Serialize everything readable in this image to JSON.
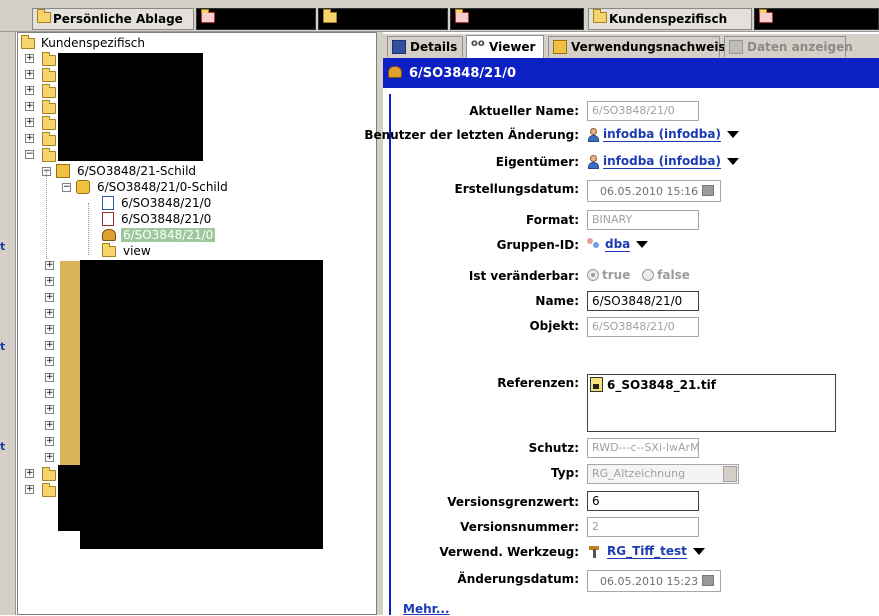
{
  "top_tabs": [
    {
      "label": "Persönliche Ablage",
      "active": false,
      "icon": "folder-icon"
    },
    {
      "label": "",
      "active": false,
      "icon": "folder-red-icon"
    },
    {
      "label": "",
      "active": false,
      "icon": "folder-icon"
    },
    {
      "label": "",
      "active": false,
      "icon": "folder-red-icon"
    },
    {
      "label": "Kundenspezifisch",
      "active": true,
      "icon": "folder-icon"
    },
    {
      "label": "",
      "active": false,
      "icon": "folder-red-icon"
    }
  ],
  "tree": {
    "root": "Kundenspezifisch",
    "nodes": [
      {
        "label": "6/SO3848/21-Schild",
        "icon": "item-icon"
      },
      {
        "label": "6/SO3848/21/0-Schild",
        "icon": "item-revision-icon"
      },
      {
        "label": "6/SO3848/21/0",
        "icon": "form-icon"
      },
      {
        "label": "6/SO3848/21/0",
        "icon": "drawing-icon"
      },
      {
        "label": "6/SO3848/21/0",
        "icon": "dataset-icon",
        "selected": true
      },
      {
        "label": "view",
        "icon": "view-icon"
      }
    ]
  },
  "right_tabs": [
    {
      "label": "Details",
      "icon": "details-icon"
    },
    {
      "label": "Viewer",
      "icon": "viewer-icon",
      "active": true
    },
    {
      "label": "Verwendungsnachweis",
      "icon": "where-used-icon"
    },
    {
      "label": "Daten anzeigen",
      "icon": "data-icon",
      "disabled": true
    }
  ],
  "title": "6/SO3848/21/0",
  "form": {
    "current_name_label": "Aktueller Name:",
    "current_name": "6/SO3848/21/0",
    "last_modified_user_label": "Benutzer der letzten Änderung:",
    "last_modified_user": "infodba (infodba)",
    "owner_label": "Eigentümer:",
    "owner": "infodba (infodba)",
    "creation_date_label": "Erstellungsdatum:",
    "creation_date": "06.05.2010 15:16",
    "format_label": "Format:",
    "format": "BINARY",
    "group_id_label": "Gruppen-ID:",
    "group_id": "dba",
    "modifiable_label": "Ist veränderbar:",
    "modifiable_true": "true",
    "modifiable_false": "false",
    "name_label": "Name:",
    "name": "6/SO3848/21/0",
    "object_label": "Objekt:",
    "object": "6/SO3848/21/0",
    "references_label": "Referenzen:",
    "reference": "6_SO3848_21.tif",
    "protection_label": "Schutz:",
    "protection": "RWD---c--SXi-lwArM",
    "type_label": "Typ:",
    "type": "RG_Altzeichnung",
    "revision_limit_label": "Versionsgrenzwert:",
    "revision_limit": "6",
    "version_number_label": "Versionsnummer:",
    "version_number": "2",
    "tool_label": "Verwend. Werkzeug:",
    "tool": "RG_Tiff_test",
    "modification_date_label": "Änderungsdatum:",
    "modification_date": "06.05.2010 15:23",
    "more_link": "Mehr..."
  },
  "sidebar_marks": [
    "t",
    "t",
    "t"
  ],
  "colors": {
    "title_bar": "#0c20c4",
    "link": "#1c3bb4",
    "selection": "#9cc89c"
  }
}
